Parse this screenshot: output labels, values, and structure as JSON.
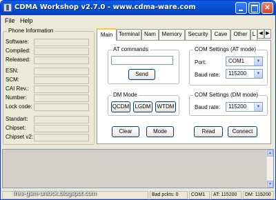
{
  "window": {
    "title": "CDMA Workshop v2.7.0  -  www.cdma-ware.com"
  },
  "menu": {
    "items": [
      "File",
      "Help"
    ]
  },
  "phone_info": {
    "title": "Phone Information",
    "labels": [
      "Software:",
      "Compiled:",
      "Released:",
      "ESN:",
      "SCM:",
      "CAI Rev.:",
      "Number:",
      "Lock code:",
      "Standart:",
      "Chipset:",
      "Chipset v2:"
    ]
  },
  "tabs": [
    "Main",
    "Terminal",
    "Nam",
    "Memory",
    "Security",
    "Cave",
    "Other",
    "L"
  ],
  "at_commands": {
    "title": "AT commands",
    "input_value": "",
    "send_label": "Send"
  },
  "com_at": {
    "title": "COM Settings (AT mode)",
    "port_label": "Port:",
    "port_value": "COM1",
    "baud_label": "Baud rate:",
    "baud_value": "115200"
  },
  "dm_mode": {
    "title": "DM Mode",
    "buttons": [
      "QCDM",
      "LGDM",
      "WTDM"
    ]
  },
  "com_dm": {
    "title": "COM Settings (DM mode)",
    "baud_label": "Baud rate:",
    "baud_value": "115200"
  },
  "actions": {
    "clear": "Clear",
    "mode": "Mode",
    "read": "Read",
    "connect": "Connect"
  },
  "status": {
    "bad_packets": "Bad pckts: 0",
    "port": "COM1",
    "at": "AT: 115200",
    "dm": "DM: 115200"
  },
  "watermark": "free-gsm-unlock.blogspot.com"
}
